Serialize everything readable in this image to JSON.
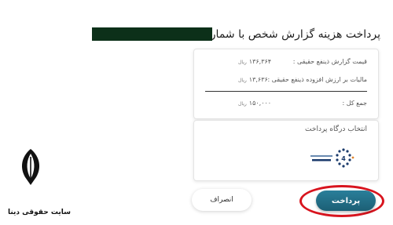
{
  "header": {
    "title": "پرداخت هزینه گزارش شخص با شماره تلفن :"
  },
  "summary": {
    "real_price_label": "قیمت گزارش ذینفع حقیقی :",
    "real_price_value": "۱۳۶,۳۶۴",
    "tax_label": "مالیات بر ارزش افزوده ذینفع حقیقی :",
    "tax_value": "۱۳,۶۳۶",
    "total_label": "جمع کل :",
    "total_value": "۱۵۰,۰۰۰",
    "currency": "ریال"
  },
  "gateway": {
    "title": "انتخاب درگاه پرداخت",
    "logo_icon": "shaparak-gateway-logo-icon"
  },
  "actions": {
    "pay_label": "پرداخت",
    "cancel_label": "انصراف"
  },
  "branding": {
    "caption": "سایت حقوقی دینا",
    "logo_icon": "quill-pen-logo-icon"
  },
  "colors": {
    "pay_button": "#1c5f75",
    "highlight": "#d8141e",
    "redaction": "#0c3019"
  }
}
